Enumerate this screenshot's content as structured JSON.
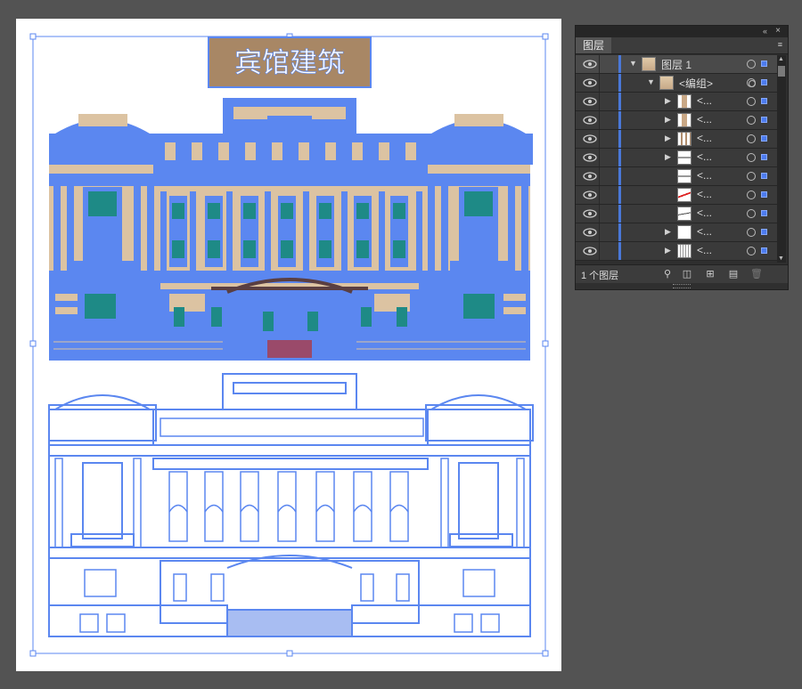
{
  "artwork": {
    "title": "宾馆建筑",
    "colors": {
      "outline": "#5b87f0",
      "facade": "#dcc3a2",
      "title_bg": "#a88765",
      "glass": "#1e8a86",
      "artboard": "#ffffff",
      "canvas": "#535353"
    }
  },
  "layers_panel": {
    "tab_label": "图层",
    "collapse_icon": "«",
    "close_icon": "×",
    "menu_icon": "≡",
    "rows": [
      {
        "name": "图层 1",
        "expanded": true,
        "thumb": "building-thumb"
      },
      {
        "name": "<编组>",
        "expanded": true,
        "thumb": "building-thumb"
      },
      {
        "name": "<...",
        "expandable": true,
        "thumb": "tall-thumb"
      },
      {
        "name": "<...",
        "expandable": true,
        "thumb": "tall-thumb"
      },
      {
        "name": "<...",
        "expandable": true,
        "thumb": "column-thumb"
      },
      {
        "name": "<...",
        "expandable": true,
        "thumb": "line-thumb"
      },
      {
        "name": "<...",
        "expandable": false,
        "thumb": "line-thumb"
      },
      {
        "name": "<...",
        "expandable": false,
        "thumb": "redline-thumb"
      },
      {
        "name": "<...",
        "expandable": false,
        "thumb": "curve-thumb"
      },
      {
        "name": "<...",
        "expandable": true,
        "thumb": "blank-thumb"
      },
      {
        "name": "<...",
        "expandable": true,
        "thumb": "dots-thumb"
      }
    ],
    "footer": {
      "count_label": "1 个图层"
    }
  }
}
